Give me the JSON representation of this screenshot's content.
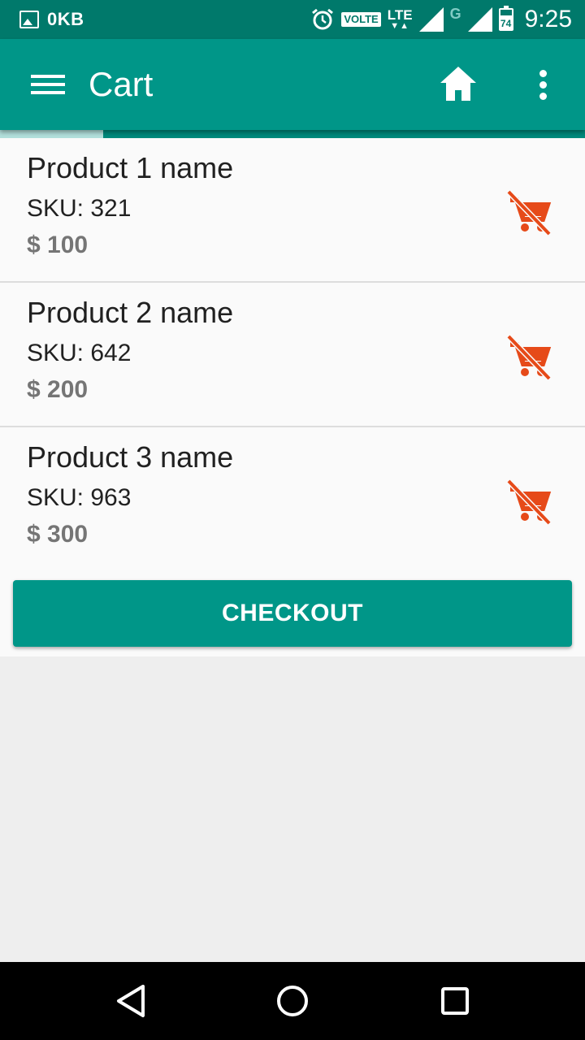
{
  "status_bar": {
    "data_usage": "0KB",
    "network_badge": "VOLTE",
    "network_type": "LTE",
    "secondary_network": "G",
    "battery_level": "74",
    "time": "9:25"
  },
  "app_bar": {
    "title": "Cart",
    "icons": [
      "menu-icon",
      "home-icon",
      "more-vert-icon"
    ]
  },
  "cart": {
    "items": [
      {
        "name": "Product 1 name",
        "sku": "SKU: 321",
        "price": "$ 100"
      },
      {
        "name": "Product 2 name",
        "sku": "SKU: 642",
        "price": "$ 200"
      },
      {
        "name": "Product 3 name",
        "sku": "SKU: 963",
        "price": "$ 300"
      }
    ],
    "remove_icon": "remove-shopping-cart-icon",
    "remove_icon_color": "#e64a19"
  },
  "checkout_label": "CHECKOUT",
  "colors": {
    "primary": "#009688",
    "primary_dark": "#00796b",
    "accent": "#e64a19"
  },
  "nav_bar": {
    "icons": [
      "back-icon",
      "home-circle-icon",
      "recents-icon"
    ]
  }
}
